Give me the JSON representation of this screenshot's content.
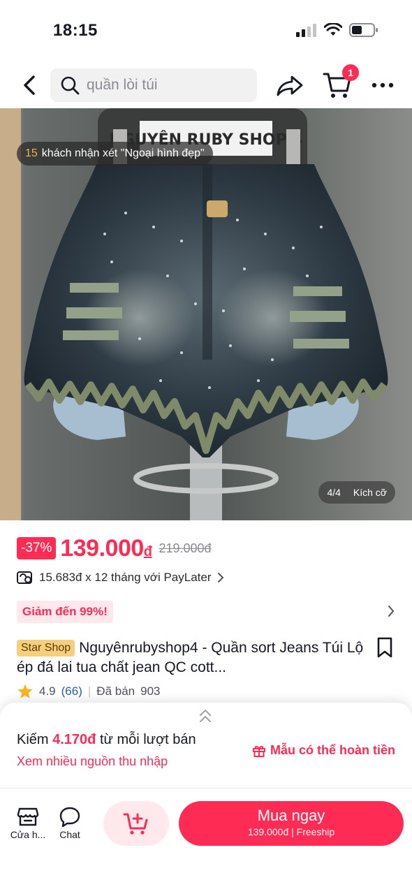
{
  "status_bar": {
    "time": "18:15"
  },
  "search": {
    "placeholder": "quần lòi túi"
  },
  "cart": {
    "badge_count": "1"
  },
  "image": {
    "review_count": "15",
    "review_text": "khách nhận xét \"Ngoại hình đẹp\"",
    "watermark": "NGUYÊN RUBY SHOP 4",
    "counter": "4/4",
    "size_label": "Kích cỡ"
  },
  "price": {
    "discount": "-37%",
    "current": "139.000",
    "currency": "đ",
    "original": "219.000đ"
  },
  "paylater": {
    "text": "15.683đ x 12 tháng với PayLater"
  },
  "promo": {
    "label": "Giảm đến 99%!"
  },
  "product": {
    "shop_tag": "Star Shop",
    "title": "Nguyênrubyshop4 -  Quần sort Jeans Túi Lộ ép đá   lai tua chất  jean QC cott..."
  },
  "rating": {
    "score": "4.9",
    "reviews": "(66)",
    "sold_label": "Đã bán",
    "sold_count": "903"
  },
  "earn": {
    "prefix": "Kiếm ",
    "amount": "4.170đ",
    "suffix": " từ mỗi lượt bán",
    "link": "Xem nhiều nguồn thu nhập",
    "refund": "Mẫu có thể hoàn tiền"
  },
  "bottom_bar": {
    "shop_label": "Cửa h...",
    "chat_label": "Chat",
    "buy_label": "Mua ngay",
    "buy_price": "139.000đ",
    "buy_ship": "Freeship"
  },
  "colors": {
    "accent": "#fe2c55",
    "promo_bg": "#ffe9ed",
    "shop_tag_bg": "#f6cf7e"
  }
}
